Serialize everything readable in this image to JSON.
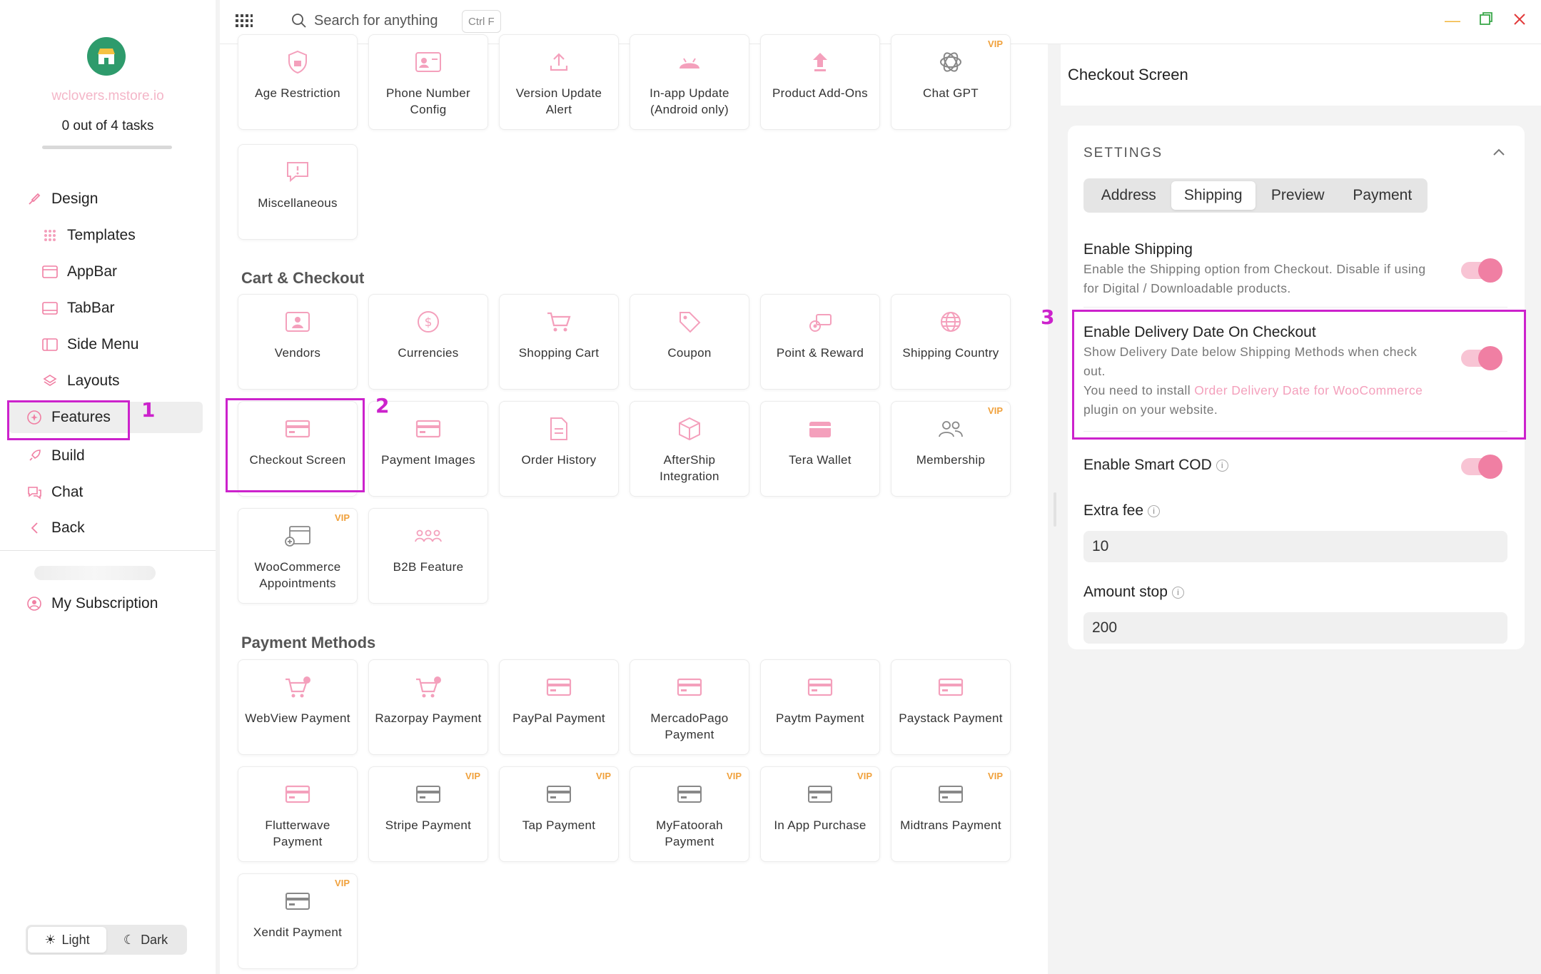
{
  "sidebar": {
    "store_name": "wclovers.mstore.io",
    "tasks": "0 out of 4 tasks",
    "items": [
      {
        "label": "Design"
      },
      {
        "label": "Templates"
      },
      {
        "label": "AppBar"
      },
      {
        "label": "TabBar"
      },
      {
        "label": "Side Menu"
      },
      {
        "label": "Layouts"
      },
      {
        "label": "Features"
      },
      {
        "label": "Build"
      },
      {
        "label": "Chat"
      },
      {
        "label": "Back"
      }
    ],
    "subscription": "My Subscription",
    "theme": {
      "light": "Light",
      "dark": "Dark",
      "selected": "Light"
    }
  },
  "topbar": {
    "search_placeholder": "Search for anything",
    "shortcut": "Ctrl F"
  },
  "main": {
    "top_cards": [
      {
        "label": "Age Restriction",
        "icon": "shield-lock-icon",
        "vip": ""
      },
      {
        "label": "Phone Number Config",
        "icon": "id-card-icon",
        "vip": ""
      },
      {
        "label": "Version Update Alert",
        "icon": "upload-icon",
        "vip": ""
      },
      {
        "label": "In-app Update (Android only)",
        "icon": "android-icon",
        "vip": ""
      },
      {
        "label": "Product Add-Ons",
        "icon": "arrow-up-icon",
        "vip": ""
      },
      {
        "label": "Chat GPT",
        "icon": "openai-icon",
        "vip": "VIP"
      },
      {
        "label": "Miscellaneous",
        "icon": "alert-bubble-icon",
        "vip": ""
      }
    ],
    "cart_section_title": "Cart & Checkout",
    "cart_cards": [
      {
        "label": "Vendors",
        "icon": "vendor-icon",
        "vip": ""
      },
      {
        "label": "Currencies",
        "icon": "dollar-icon",
        "vip": ""
      },
      {
        "label": "Shopping Cart",
        "icon": "cart-icon",
        "vip": ""
      },
      {
        "label": "Coupon",
        "icon": "tag-icon",
        "vip": ""
      },
      {
        "label": "Point & Reward",
        "icon": "reward-icon",
        "vip": ""
      },
      {
        "label": "Shipping Country",
        "icon": "globe-icon",
        "vip": ""
      },
      {
        "label": "Checkout Screen",
        "icon": "card-icon",
        "vip": ""
      },
      {
        "label": "Payment Images",
        "icon": "card-icon",
        "vip": ""
      },
      {
        "label": "Order History",
        "icon": "document-icon",
        "vip": ""
      },
      {
        "label": "AfterShip Integration",
        "icon": "box-icon",
        "vip": ""
      },
      {
        "label": "Tera Wallet",
        "icon": "wallet-icon",
        "vip": ""
      },
      {
        "label": "Membership",
        "icon": "users-icon",
        "vip": "VIP"
      },
      {
        "label": "WooCommerce Appointments",
        "icon": "calendar-icon",
        "vip": "VIP"
      },
      {
        "label": "B2B Feature",
        "icon": "group-icon",
        "vip": ""
      }
    ],
    "payment_section_title": "Payment Methods",
    "payment_cards": [
      {
        "label": "WebView Payment",
        "icon": "cart-plus-icon",
        "vip": ""
      },
      {
        "label": "Razorpay Payment",
        "icon": "cart-plus-icon",
        "vip": ""
      },
      {
        "label": "PayPal Payment",
        "icon": "card-icon",
        "vip": ""
      },
      {
        "label": "MercadoPago Payment",
        "icon": "card-icon",
        "vip": ""
      },
      {
        "label": "Paytm Payment",
        "icon": "card-icon",
        "vip": ""
      },
      {
        "label": "Paystack Payment",
        "icon": "card-icon",
        "vip": ""
      },
      {
        "label": "Flutterwave Payment",
        "icon": "card-icon",
        "vip": ""
      },
      {
        "label": "Stripe Payment",
        "icon": "card-icon",
        "vip": "VIP"
      },
      {
        "label": "Tap Payment",
        "icon": "card-icon",
        "vip": "VIP"
      },
      {
        "label": "MyFatoorah Payment",
        "icon": "card-icon",
        "vip": "VIP"
      },
      {
        "label": "In App Purchase",
        "icon": "card-icon",
        "vip": "VIP"
      },
      {
        "label": "Midtrans Payment",
        "icon": "card-icon",
        "vip": "VIP"
      },
      {
        "label": "Xendit Payment",
        "icon": "card-icon",
        "vip": "VIP"
      }
    ]
  },
  "annotations": [
    "1",
    "2",
    "3"
  ],
  "panel": {
    "title": "Checkout Screen",
    "settings_label": "SETTINGS",
    "tabs": [
      "Address",
      "Shipping",
      "Preview",
      "Payment"
    ],
    "selected_tab": "Shipping",
    "enable_shipping": {
      "title": "Enable Shipping",
      "desc": "Enable the Shipping option from Checkout. Disable if using for Digital / Downloadable products."
    },
    "delivery_date": {
      "title": "Enable Delivery Date On Checkout",
      "desc": "Show Delivery Date below Shipping Methods when check out.",
      "install_prefix": "You need to install ",
      "install_link": "Order Delivery Date for WooCommerce",
      "install_suffix": " plugin on your website."
    },
    "smart_cod": {
      "title": "Enable Smart COD"
    },
    "extra_fee": {
      "label": "Extra fee",
      "value": "10"
    },
    "amount_stop": {
      "label": "Amount stop",
      "value": "200"
    }
  },
  "colors": {
    "accent_pink": "#f07fa3",
    "annotation": "#cc22cc",
    "vip": "#f0a13c"
  }
}
